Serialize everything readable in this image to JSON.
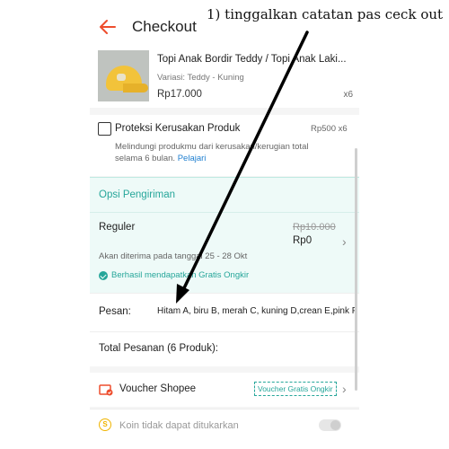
{
  "header": {
    "title": "Checkout",
    "back_icon": "arrow-left-icon"
  },
  "product": {
    "name": "Topi Anak Bordir Teddy / Topi Anak Laki...",
    "variant": "Variasi: Teddy - Kuning",
    "price": "Rp17.000",
    "quantity": "x6"
  },
  "protection": {
    "title": "Proteksi Kerusakan Produk",
    "price": "Rp500  x6",
    "description": "Melindungi produkmu dari kerusakan/kerugian total selama 6 bulan. ",
    "link": "Pelajari",
    "checked": false
  },
  "shipping": {
    "section_title": "Opsi Pengiriman",
    "option_name": "Reguler",
    "old_price": "Rp10.000",
    "new_price": "Rp0",
    "eta": "Akan diterima pada tanggal 25 - 28 Okt",
    "free_shipping": "Berhasil mendapatkan Gratis Ongkir"
  },
  "message": {
    "label": "Pesan:",
    "value": "Hitam A, biru B, merah C, kuning D,crean E,pink F"
  },
  "total": {
    "label": "Total Pesanan (6 Produk):"
  },
  "voucher": {
    "label": "Voucher Shopee",
    "tag": "Voucher Gratis Ongkir"
  },
  "coins": {
    "icon_letter": "S",
    "label": "Koin tidak dapat ditukarkan",
    "enabled": false
  },
  "annotation": {
    "text": "1) tinggalkan catatan pas ceck out"
  },
  "colors": {
    "accent": "#ee4d2d",
    "teal": "#26a69a",
    "link": "#1f7fd0"
  }
}
